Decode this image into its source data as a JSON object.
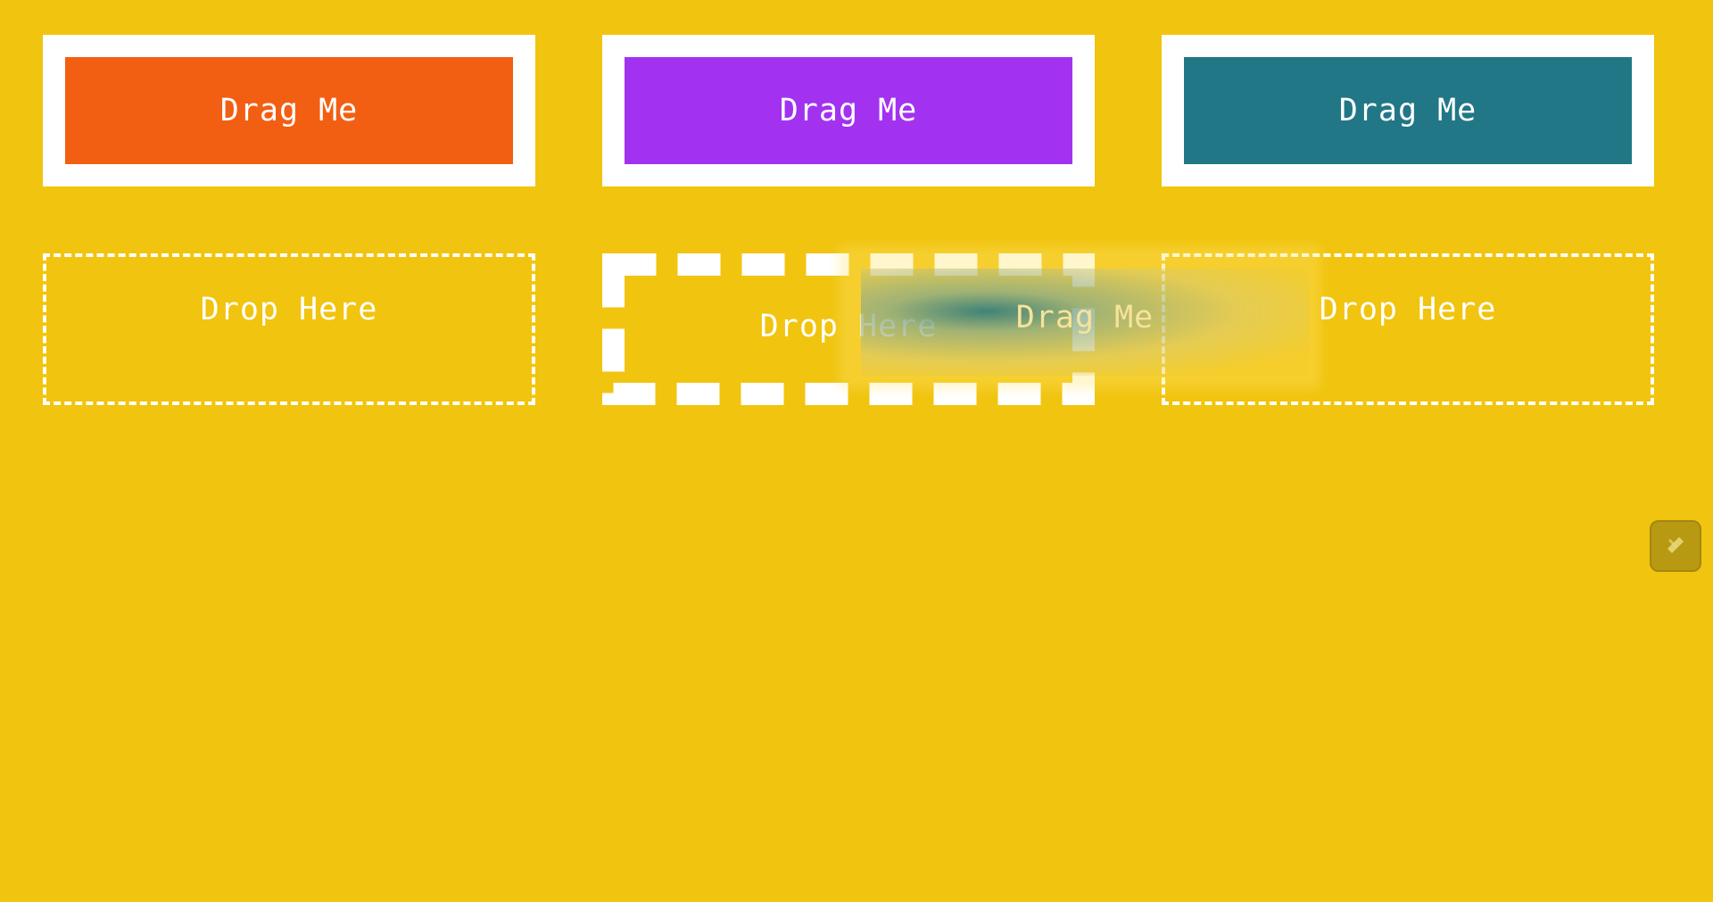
{
  "drag_cards": [
    {
      "label": "Drag Me",
      "color": "#F25F13"
    },
    {
      "label": "Drag Me",
      "color": "#A232F0"
    },
    {
      "label": "Drag Me",
      "color": "#217786"
    }
  ],
  "drop_zones": [
    {
      "label": "Drop Here",
      "state": "idle"
    },
    {
      "label": "Drop Here",
      "state": "hover"
    },
    {
      "label": "Drop Here",
      "state": "idle"
    }
  ],
  "drag_ghost": {
    "label": "Drag Me",
    "source_color": "#217786"
  },
  "tool_button": {
    "icon": "pen-icon"
  },
  "colors": {
    "background": "#F1C40F",
    "card_frame": "#FFFFFF",
    "zone_border": "#FFFFFF"
  }
}
